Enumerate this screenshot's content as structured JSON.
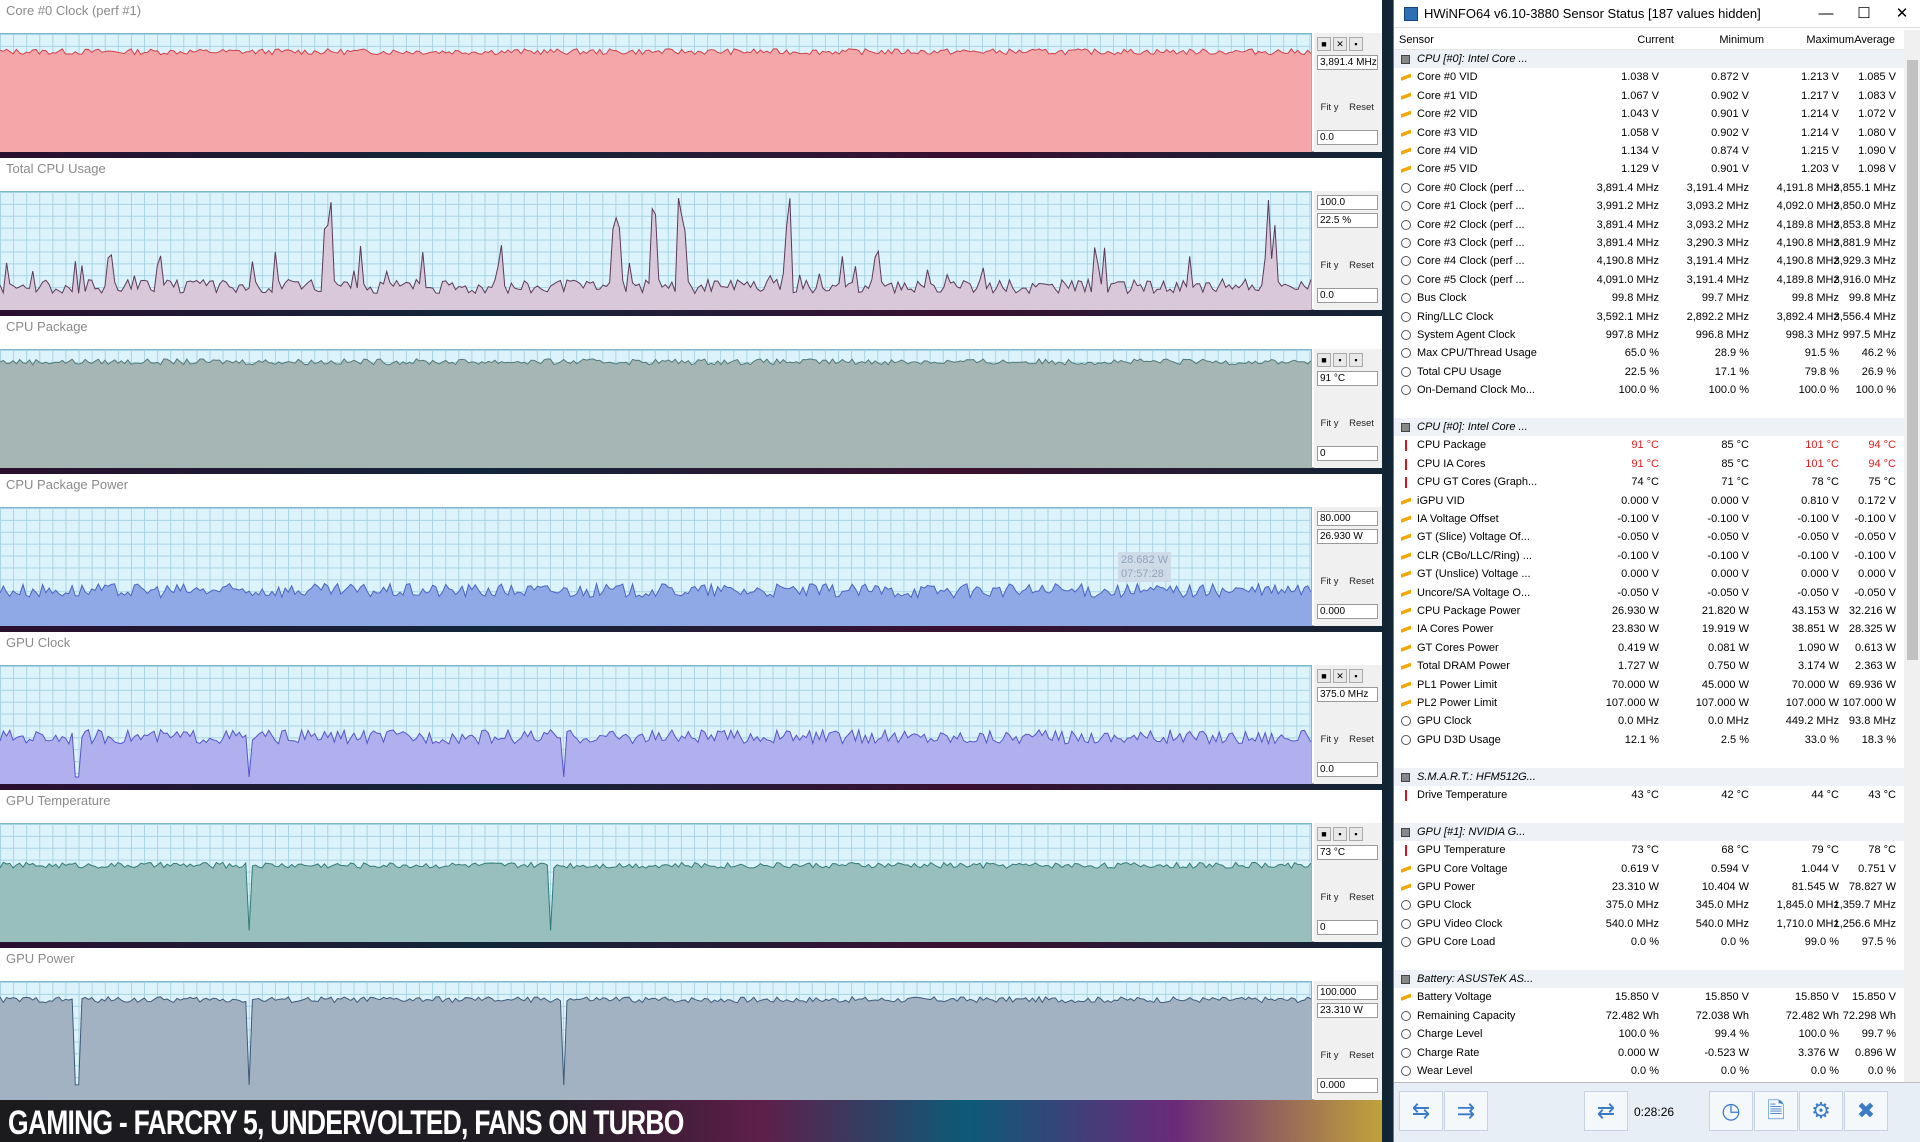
{
  "graphs": [
    {
      "title": "Core #0 Clock (perf #1)",
      "values": [
        "3,891.4 MHz"
      ],
      "bottom": "0.0",
      "color": "#f4a6a8",
      "line": "#d0404a",
      "level": 0.85,
      "spikes": [],
      "icons": [
        "■",
        "✕",
        "▪"
      ]
    },
    {
      "title": "Total CPU Usage",
      "values": [
        "100.0",
        "22.5 %"
      ],
      "bottom": "0.0",
      "color": "#d9c8d9",
      "line": "#5a3a5a",
      "level": 0.2,
      "spikes": [
        0.25,
        0.47,
        0.5,
        0.52,
        0.6,
        0.97
      ],
      "icons": []
    },
    {
      "title": "CPU Package",
      "values": [
        "91 °C"
      ],
      "bottom": "0",
      "color": "#a6b6b4",
      "line": "#4f7a78",
      "level": 0.9,
      "spikes": [],
      "icons": [
        "■",
        "▪",
        "▪"
      ]
    },
    {
      "title": "CPU Package Power",
      "values": [
        "80.000",
        "26.930 W"
      ],
      "bottom": "0.000",
      "color": "#8fa8e6",
      "line": "#4a64c2",
      "level": 0.3,
      "spikes": [],
      "icons": [],
      "tooltip": [
        "28.682 W",
        "07:57:28"
      ]
    },
    {
      "title": "GPU Clock",
      "values": [
        "375.0 MHz"
      ],
      "bottom": "0.0",
      "color": "#b0b0ee",
      "line": "#5656c8",
      "level": 0.4,
      "spikes": [],
      "dips": [
        0.06,
        0.19,
        0.43
      ],
      "icons": [
        "■",
        "✕",
        "▪"
      ]
    },
    {
      "title": "GPU Temperature",
      "values": [
        "73 °C"
      ],
      "bottom": "0",
      "color": "#98bfbd",
      "line": "#2f7c78",
      "level": 0.65,
      "spikes": [],
      "dips": [
        0.19,
        0.42
      ],
      "icons": [
        "■",
        "▪",
        "▪"
      ]
    },
    {
      "title": "GPU Power",
      "values": [
        "100.000",
        "23.310 W"
      ],
      "bottom": "0.000",
      "color": "#a3b2c2",
      "line": "#3d5a7a",
      "level": 0.85,
      "spikes": [],
      "dips": [
        0.06,
        0.19,
        0.43
      ],
      "icons": []
    }
  ],
  "graph_buttons": {
    "fit": "Fit y",
    "reset": "Reset"
  },
  "caption": "GAMING - FARCRY 5, UNDERVOLTED, FANS ON TURBO",
  "hwinfo": {
    "title": "HWiNFO64 v6.10-3880 Sensor Status [187 values hidden]",
    "window_buttons": [
      "—",
      "☐",
      "✕"
    ],
    "columns": [
      "Sensor",
      "Current",
      "Minimum",
      "Maximum",
      "Average"
    ],
    "rows": [
      {
        "g": true,
        "n": "CPU [#0]: Intel Core ..."
      },
      {
        "i": "volt",
        "n": "Core #0 VID",
        "v": [
          "1.038 V",
          "0.872 V",
          "1.213 V",
          "1.085 V"
        ]
      },
      {
        "i": "volt",
        "n": "Core #1 VID",
        "v": [
          "1.067 V",
          "0.902 V",
          "1.217 V",
          "1.083 V"
        ]
      },
      {
        "i": "volt",
        "n": "Core #2 VID",
        "v": [
          "1.043 V",
          "0.901 V",
          "1.214 V",
          "1.072 V"
        ]
      },
      {
        "i": "volt",
        "n": "Core #3 VID",
        "v": [
          "1.058 V",
          "0.902 V",
          "1.214 V",
          "1.080 V"
        ]
      },
      {
        "i": "volt",
        "n": "Core #4 VID",
        "v": [
          "1.134 V",
          "0.874 V",
          "1.215 V",
          "1.090 V"
        ]
      },
      {
        "i": "volt",
        "n": "Core #5 VID",
        "v": [
          "1.129 V",
          "0.901 V",
          "1.203 V",
          "1.098 V"
        ]
      },
      {
        "i": "clock",
        "n": "Core #0 Clock (perf ...",
        "v": [
          "3,891.4 MHz",
          "3,191.4 MHz",
          "4,191.8 MHz",
          "3,855.1 MHz"
        ]
      },
      {
        "i": "clock",
        "n": "Core #1 Clock (perf ...",
        "v": [
          "3,991.2 MHz",
          "3,093.2 MHz",
          "4,092.0 MHz",
          "3,850.0 MHz"
        ]
      },
      {
        "i": "clock",
        "n": "Core #2 Clock (perf ...",
        "v": [
          "3,891.4 MHz",
          "3,093.2 MHz",
          "4,189.8 MHz",
          "3,853.8 MHz"
        ]
      },
      {
        "i": "clock",
        "n": "Core #3 Clock (perf ...",
        "v": [
          "3,891.4 MHz",
          "3,290.3 MHz",
          "4,190.8 MHz",
          "3,881.9 MHz"
        ]
      },
      {
        "i": "clock",
        "n": "Core #4 Clock (perf ...",
        "v": [
          "4,190.8 MHz",
          "3,191.4 MHz",
          "4,190.8 MHz",
          "3,929.3 MHz"
        ]
      },
      {
        "i": "clock",
        "n": "Core #5 Clock (perf ...",
        "v": [
          "4,091.0 MHz",
          "3,191.4 MHz",
          "4,189.8 MHz",
          "3,916.0 MHz"
        ]
      },
      {
        "i": "clock",
        "n": "Bus Clock",
        "v": [
          "99.8 MHz",
          "99.7 MHz",
          "99.8 MHz",
          "99.8 MHz"
        ]
      },
      {
        "i": "clock",
        "n": "Ring/LLC Clock",
        "v": [
          "3,592.1 MHz",
          "2,892.2 MHz",
          "3,892.4 MHz",
          "3,556.4 MHz"
        ]
      },
      {
        "i": "clock",
        "n": "System Agent Clock",
        "v": [
          "997.8 MHz",
          "996.8 MHz",
          "998.3 MHz",
          "997.5 MHz"
        ]
      },
      {
        "i": "clock",
        "n": "Max CPU/Thread Usage",
        "v": [
          "65.0 %",
          "28.9 %",
          "91.5 %",
          "46.2 %"
        ]
      },
      {
        "i": "clock",
        "n": "Total CPU Usage",
        "v": [
          "22.5 %",
          "17.1 %",
          "79.8 %",
          "26.9 %"
        ]
      },
      {
        "i": "clock",
        "n": "On-Demand Clock Mo...",
        "v": [
          "100.0 %",
          "100.0 %",
          "100.0 %",
          "100.0 %"
        ]
      },
      {
        "blank": true
      },
      {
        "g": true,
        "n": "CPU [#0]: Intel Core ..."
      },
      {
        "i": "temp",
        "n": "CPU Package",
        "v": [
          "91 °C",
          "85 °C",
          "101 °C",
          "94 °C"
        ],
        "hot": [
          0,
          2,
          3
        ]
      },
      {
        "i": "temp",
        "n": "CPU IA Cores",
        "v": [
          "91 °C",
          "85 °C",
          "101 °C",
          "94 °C"
        ],
        "hot": [
          0,
          2,
          3
        ]
      },
      {
        "i": "temp",
        "n": "CPU GT Cores (Graph...",
        "v": [
          "74 °C",
          "71 °C",
          "78 °C",
          "75 °C"
        ]
      },
      {
        "i": "volt",
        "n": "iGPU VID",
        "v": [
          "0.000 V",
          "0.000 V",
          "0.810 V",
          "0.172 V"
        ]
      },
      {
        "i": "volt",
        "n": "IA Voltage Offset",
        "v": [
          "-0.100 V",
          "-0.100 V",
          "-0.100 V",
          "-0.100 V"
        ]
      },
      {
        "i": "volt",
        "n": "GT (Slice) Voltage Of...",
        "v": [
          "-0.050 V",
          "-0.050 V",
          "-0.050 V",
          "-0.050 V"
        ]
      },
      {
        "i": "volt",
        "n": "CLR (CBo/LLC/Ring) ...",
        "v": [
          "-0.100 V",
          "-0.100 V",
          "-0.100 V",
          "-0.100 V"
        ]
      },
      {
        "i": "volt",
        "n": "GT (Unslice) Voltage ...",
        "v": [
          "0.000 V",
          "0.000 V",
          "0.000 V",
          "0.000 V"
        ]
      },
      {
        "i": "volt",
        "n": "Uncore/SA Voltage O...",
        "v": [
          "-0.050 V",
          "-0.050 V",
          "-0.050 V",
          "-0.050 V"
        ]
      },
      {
        "i": "volt",
        "n": "CPU Package Power",
        "v": [
          "26.930 W",
          "21.820 W",
          "43.153 W",
          "32.216 W"
        ]
      },
      {
        "i": "volt",
        "n": "IA Cores Power",
        "v": [
          "23.830 W",
          "19.919 W",
          "38.851 W",
          "28.325 W"
        ]
      },
      {
        "i": "volt",
        "n": "GT Cores Power",
        "v": [
          "0.419 W",
          "0.081 W",
          "1.090 W",
          "0.613 W"
        ]
      },
      {
        "i": "volt",
        "n": "Total DRAM Power",
        "v": [
          "1.727 W",
          "0.750 W",
          "3.174 W",
          "2.363 W"
        ]
      },
      {
        "i": "volt",
        "n": "PL1 Power Limit",
        "v": [
          "70.000 W",
          "45.000 W",
          "70.000 W",
          "69.936 W"
        ]
      },
      {
        "i": "volt",
        "n": "PL2 Power Limit",
        "v": [
          "107.000 W",
          "107.000 W",
          "107.000 W",
          "107.000 W"
        ]
      },
      {
        "i": "clock",
        "n": "GPU Clock",
        "v": [
          "0.0 MHz",
          "0.0 MHz",
          "449.2 MHz",
          "93.8 MHz"
        ]
      },
      {
        "i": "clock",
        "n": "GPU D3D Usage",
        "v": [
          "12.1 %",
          "2.5 %",
          "33.0 %",
          "18.3 %"
        ]
      },
      {
        "blank": true
      },
      {
        "g": true,
        "n": "S.M.A.R.T.: HFM512G..."
      },
      {
        "i": "temp",
        "n": "Drive Temperature",
        "v": [
          "43 °C",
          "42 °C",
          "44 °C",
          "43 °C"
        ]
      },
      {
        "blank": true
      },
      {
        "g": true,
        "n": "GPU [#1]: NVIDIA G..."
      },
      {
        "i": "temp",
        "n": "GPU Temperature",
        "v": [
          "73 °C",
          "68 °C",
          "79 °C",
          "78 °C"
        ]
      },
      {
        "i": "volt",
        "n": "GPU Core Voltage",
        "v": [
          "0.619 V",
          "0.594 V",
          "1.044 V",
          "0.751 V"
        ]
      },
      {
        "i": "volt",
        "n": "GPU Power",
        "v": [
          "23.310 W",
          "10.404 W",
          "81.545 W",
          "78.827 W"
        ]
      },
      {
        "i": "clock",
        "n": "GPU Clock",
        "v": [
          "375.0 MHz",
          "345.0 MHz",
          "1,845.0 MHz",
          "1,359.7 MHz"
        ]
      },
      {
        "i": "clock",
        "n": "GPU Video Clock",
        "v": [
          "540.0 MHz",
          "540.0 MHz",
          "1,710.0 MHz",
          "1,256.6 MHz"
        ]
      },
      {
        "i": "clock",
        "n": "GPU Core Load",
        "v": [
          "0.0 %",
          "0.0 %",
          "99.0 %",
          "97.5 %"
        ]
      },
      {
        "blank": true
      },
      {
        "g": true,
        "n": "Battery: ASUSTeK AS..."
      },
      {
        "i": "volt",
        "n": "Battery Voltage",
        "v": [
          "15.850 V",
          "15.850 V",
          "15.850 V",
          "15.850 V"
        ]
      },
      {
        "i": "clock",
        "n": "Remaining Capacity",
        "v": [
          "72.482 Wh",
          "72.038 Wh",
          "72.482 Wh",
          "72.298 Wh"
        ]
      },
      {
        "i": "clock",
        "n": "Charge Level",
        "v": [
          "100.0 %",
          "99.4 %",
          "100.0 %",
          "99.7 %"
        ]
      },
      {
        "i": "clock",
        "n": "Charge Rate",
        "v": [
          "0.000 W",
          "-0.523 W",
          "3.376 W",
          "0.896 W"
        ]
      },
      {
        "i": "clock",
        "n": "Wear Level",
        "v": [
          "0.0 %",
          "0.0 %",
          "0.0 %",
          "0.0 %"
        ]
      }
    ],
    "footer": {
      "time": "0:28:26",
      "buttons": [
        "⇆",
        "⇉",
        "⇄",
        "◷",
        "🗎",
        "⚙",
        "✖"
      ]
    }
  }
}
